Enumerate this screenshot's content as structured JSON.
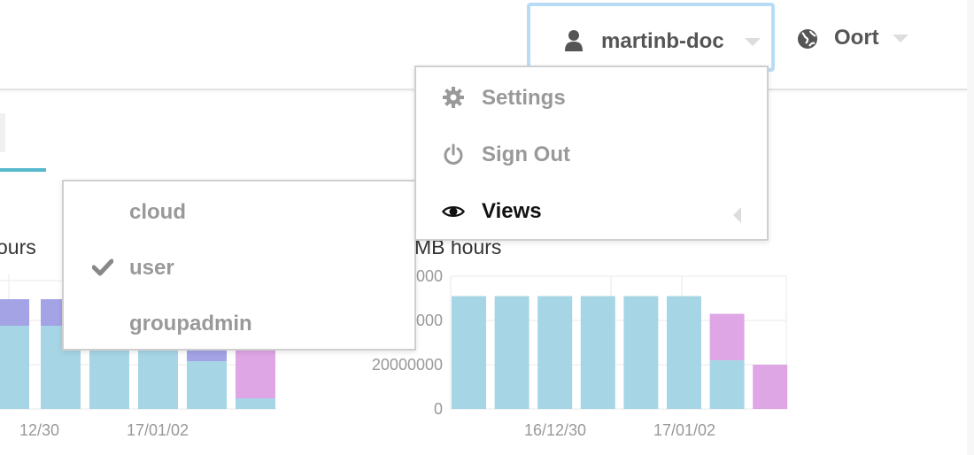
{
  "header": {
    "user_menu": {
      "label": "martinb-doc",
      "icon": "user-icon"
    },
    "site_menu": {
      "label": "Oort",
      "icon": "globe-icon"
    }
  },
  "user_dropdown": {
    "items": [
      {
        "label": "Settings",
        "icon": "gear-icon"
      },
      {
        "label": "Sign Out",
        "icon": "power-icon"
      },
      {
        "label": "Views",
        "icon": "eye-icon",
        "active": true
      }
    ]
  },
  "views_submenu": {
    "items": [
      {
        "label": "cloud",
        "checked": false
      },
      {
        "label": "user",
        "checked": true
      },
      {
        "label": "groupadmin",
        "checked": false
      }
    ]
  },
  "colors": {
    "cyan": "#a6d6e5",
    "purple": "#a3a3e6",
    "pink": "#dea6e5",
    "accent": "#55b8cc"
  },
  "chart_data": [
    {
      "type": "bar",
      "title": "ours",
      "x_tick_labels": [
        "12/30",
        "17/01/02"
      ],
      "series": [
        {
          "values": [
            47,
            47,
            47,
            47,
            27,
            6
          ]
        },
        {
          "values": [
            15,
            15,
            0,
            0,
            14,
            0
          ]
        },
        {
          "values": [
            0,
            0,
            0,
            0,
            0,
            29
          ]
        }
      ]
    },
    {
      "type": "bar",
      "title": "MB hours",
      "y_tick_labels": [
        "0",
        "20000000",
        "000",
        "000"
      ],
      "x_tick_labels": [
        "16/12/30",
        "17/01/02"
      ],
      "ylim": [
        0,
        60000000
      ],
      "series": [
        {
          "values": [
            51000000,
            51000000,
            51000000,
            51000000,
            51000000,
            51000000,
            22000000,
            0
          ]
        },
        {
          "values": [
            0,
            0,
            0,
            0,
            0,
            0,
            21000000,
            20000000
          ]
        }
      ]
    }
  ]
}
